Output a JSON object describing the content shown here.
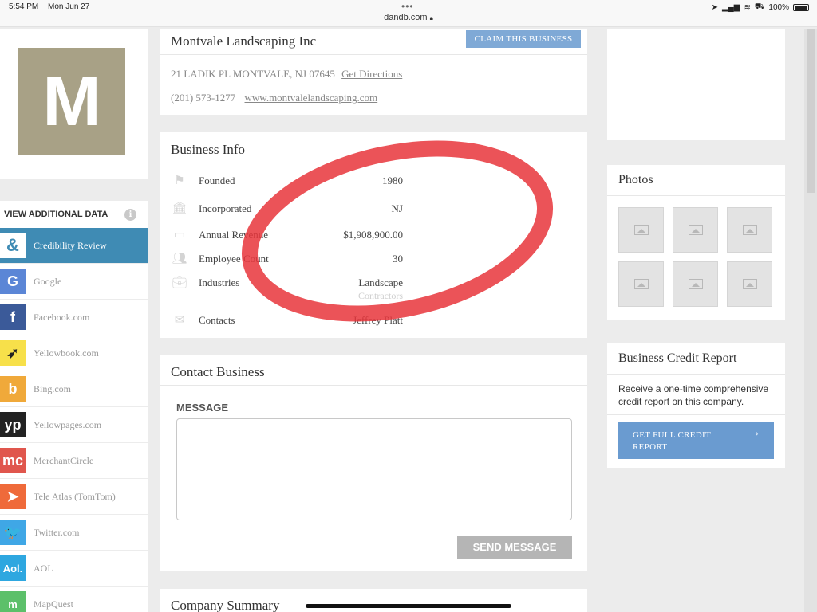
{
  "status_bar": {
    "time": "5:54 PM",
    "date": "Mon Jun 27",
    "url": "dandb.com",
    "battery": "100%",
    "menu_dots": "•••"
  },
  "business": {
    "name": "Montvale Landscaping Inc",
    "logo_letter": "M",
    "claim_label": "CLAIM THIS BUSINESS",
    "address": "21 LADIK PL MONTVALE, NJ 07645",
    "directions_label": "Get Directions",
    "phone": "(201) 573-1277",
    "website": "www.montvalelandscaping.com"
  },
  "additional_data": {
    "title": "VIEW ADDITIONAL DATA",
    "info_glyph": "i",
    "sources": [
      {
        "label": "Credibility Review",
        "icon": "credibility-icon",
        "glyph": "&",
        "color": "#ffffff"
      },
      {
        "label": "Google",
        "icon": "google-icon",
        "glyph": "G",
        "color": "#5b86d6"
      },
      {
        "label": "Facebook.com",
        "icon": "facebook-icon",
        "glyph": "f",
        "color": "#3b5a99"
      },
      {
        "label": "Yellowbook.com",
        "icon": "yellowbook-icon",
        "glyph": "➶",
        "color": "#f7e04a"
      },
      {
        "label": "Bing.com",
        "icon": "bing-icon",
        "glyph": "b",
        "color": "#f0a93a"
      },
      {
        "label": "Yellowpages.com",
        "icon": "yellowpages-icon",
        "glyph": "yp",
        "color": "#222222"
      },
      {
        "label": "MerchantCircle",
        "icon": "merchantcircle-icon",
        "glyph": "mc",
        "color": "#e0564d"
      },
      {
        "label": "Tele Atlas (TomTom)",
        "icon": "teleatlas-icon",
        "glyph": "➤",
        "color": "#ef6a3a"
      },
      {
        "label": "Twitter.com",
        "icon": "twitter-icon",
        "glyph": "🐦",
        "color": "#3fa7e6"
      },
      {
        "label": "AOL",
        "icon": "aol-icon",
        "glyph": "Aol.",
        "color": "#2ea7e0"
      },
      {
        "label": "MapQuest",
        "icon": "mapquest-icon",
        "glyph": "m",
        "color": "#5cc06a"
      }
    ]
  },
  "business_info": {
    "title": "Business Info",
    "rows": [
      {
        "label": "Founded",
        "value": "1980",
        "icon": "flag-icon"
      },
      {
        "label": "Incorporated",
        "value": "NJ",
        "icon": "bank-icon"
      },
      {
        "label": "Annual Revenue",
        "value": "$1,908,900.00",
        "icon": "money-icon"
      },
      {
        "label": "Employee Count",
        "value": "30",
        "icon": "people-icon"
      },
      {
        "label": "Industries",
        "value": "Landscape",
        "value_faded": "Contractors",
        "icon": "briefcase-icon"
      },
      {
        "label": "Contacts",
        "value": "Jeffrey Platt",
        "icon": "envelope-icon"
      }
    ]
  },
  "contact": {
    "title": "Contact Business",
    "message_label": "MESSAGE",
    "send_label": "SEND MESSAGE"
  },
  "summary": {
    "title": "Company Summary"
  },
  "photos": {
    "title": "Photos",
    "count": 6
  },
  "credit": {
    "title": "Business Credit Report",
    "description": "Receive a one-time comprehensive credit report on this company.",
    "button_label": "GET FULL CREDIT REPORT",
    "arrow": "→"
  },
  "annotation_color": "#e8353b"
}
